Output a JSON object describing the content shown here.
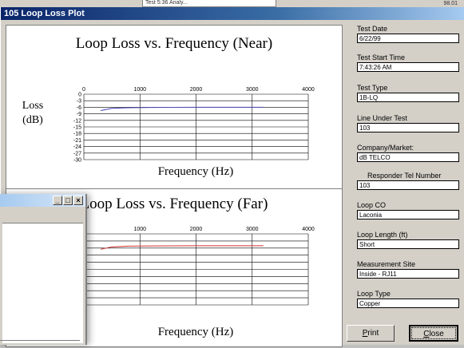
{
  "window": {
    "title": "105 Loop Loss Plot"
  },
  "background": {
    "input_text": "Test 5:36 Analy...",
    "number_text": "98.01"
  },
  "colors": {
    "near_line": "#4a4ab8",
    "far_line": "#d03030",
    "title_bar": "#0a246a"
  },
  "overlay_window": {
    "controls": [
      "_",
      "□",
      "×"
    ]
  },
  "plots": [
    {
      "title": "Loop Loss vs. Frequency (Near)",
      "xlabel": "Frequency (Hz)",
      "ylabel_line1": "Loss",
      "ylabel_line2": "(dB)",
      "xticks": [
        "0",
        "1000",
        "2000",
        "3000",
        "4000"
      ],
      "yticks": [
        "0",
        "-3",
        "-6",
        "-9",
        "-12",
        "-15",
        "-18",
        "-21",
        "-24",
        "-27",
        "-30"
      ]
    },
    {
      "title": "Loop Loss vs. Frequency (Far)",
      "xlabel": "Frequency (Hz)",
      "xticks": [
        "1000",
        "2000",
        "3000",
        "4000"
      ]
    }
  ],
  "chart_data": [
    {
      "type": "line",
      "title": "Loop Loss vs. Frequency (Near)",
      "xlabel": "Frequency (Hz)",
      "ylabel": "Loss (dB)",
      "xlim": [
        0,
        4000
      ],
      "ylim": [
        -30,
        0
      ],
      "grid": true,
      "series": [
        {
          "x": [
            300,
            500,
            800,
            1200,
            2000,
            3000,
            3200
          ],
          "y": [
            -7.5,
            -6.5,
            -6.2,
            -6.1,
            -6.0,
            -6.0,
            -6.0
          ]
        }
      ]
    },
    {
      "type": "line",
      "title": "Loop Loss vs. Frequency (Far)",
      "xlabel": "Frequency (Hz)",
      "xlim": [
        0,
        4000
      ],
      "ylim": [
        -30,
        0
      ],
      "grid": true,
      "series": [
        {
          "x": [
            300,
            500,
            800,
            1200,
            2000,
            3000,
            3200
          ],
          "y": [
            -6.5,
            -5.5,
            -5.2,
            -5.1,
            -5.0,
            -5.0,
            -5.0
          ]
        }
      ]
    }
  ],
  "fields": [
    {
      "label": "Test Date",
      "value": "6/22/99"
    },
    {
      "label": "Test Start Time",
      "value": "7:43:26 AM"
    },
    {
      "label": "Test Type",
      "value": "1B-LQ"
    },
    {
      "label": "Line  Under Test",
      "value": "103"
    },
    {
      "label": "Company/Market:",
      "value": "dB TELCO"
    },
    {
      "label": "Responder Tel Number",
      "value": "103"
    },
    {
      "label": "Loop CO",
      "value": "Laconia"
    },
    {
      "label": "Loop Length (ft)",
      "value": "Short"
    },
    {
      "label": "Measurement Site",
      "value": "Inside - RJ11"
    },
    {
      "label": "Loop Type",
      "value": "Copper"
    }
  ],
  "buttons": {
    "print": {
      "label_u": "P",
      "label_rest": "rint"
    },
    "close": {
      "label_u": "C",
      "label_rest": "lose"
    }
  }
}
